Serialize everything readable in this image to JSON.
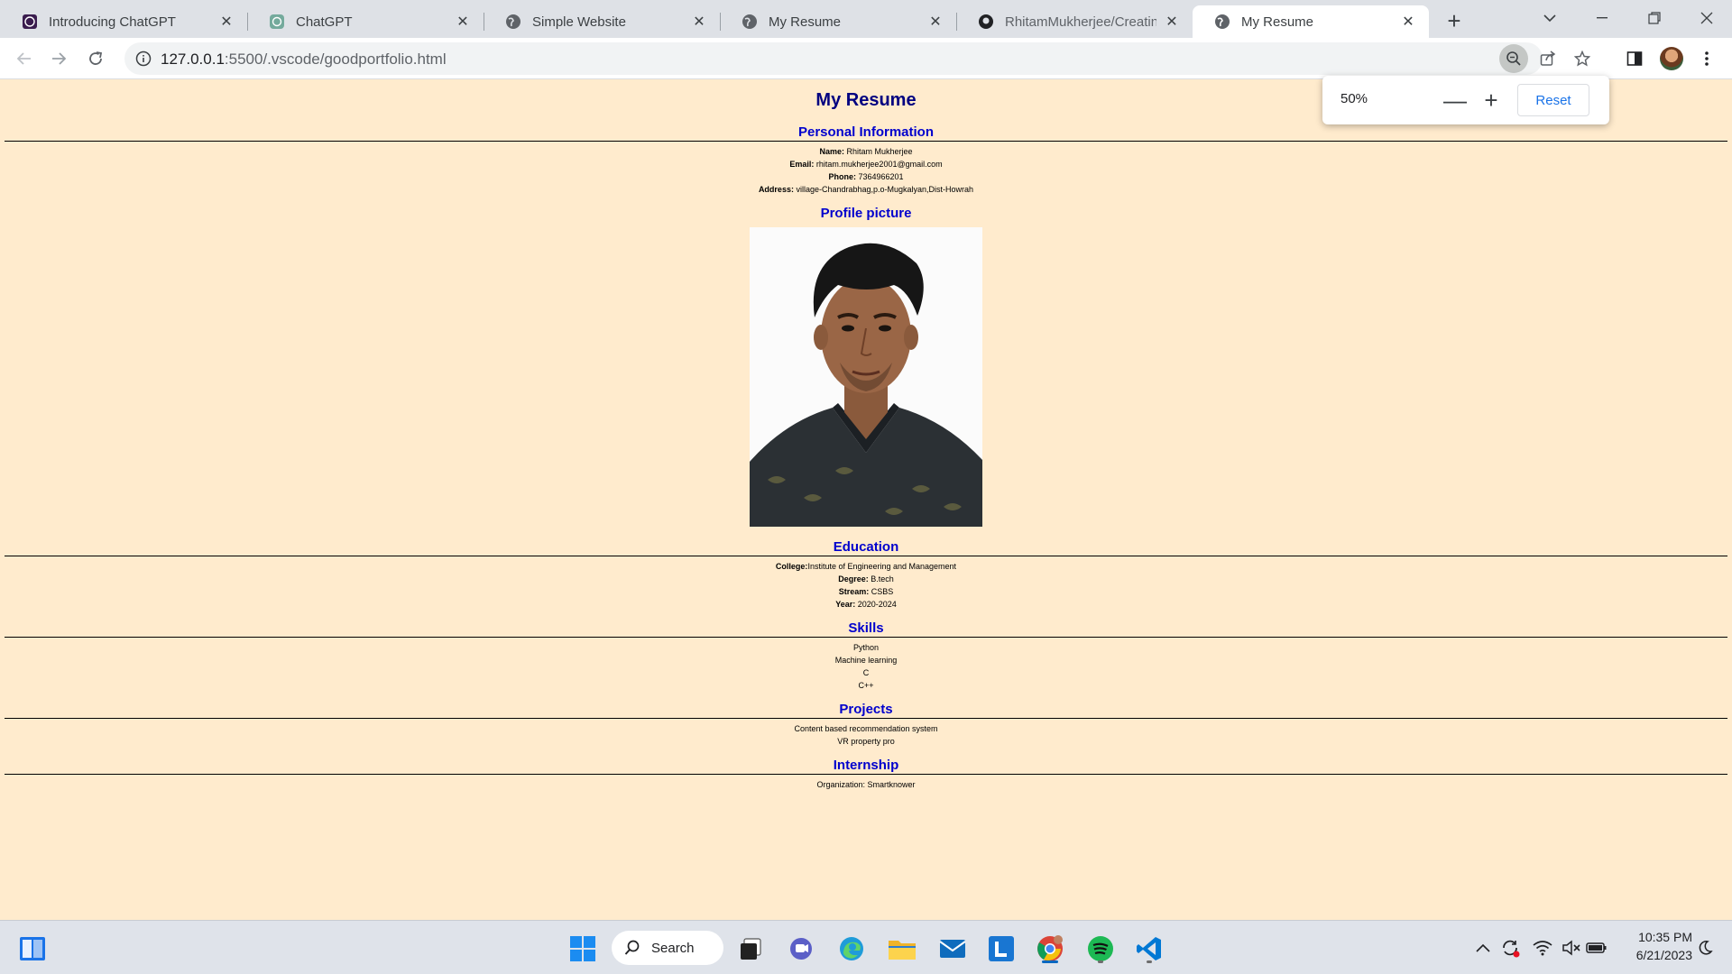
{
  "tabs": [
    {
      "title": "Introducing ChatGPT",
      "icon": "openai-icon"
    },
    {
      "title": "ChatGPT",
      "icon": "chatgpt-icon"
    },
    {
      "title": "Simple Website",
      "icon": "globe-icon"
    },
    {
      "title": "My Resume",
      "icon": "globe-icon"
    },
    {
      "title": "RhitamMukherjee/Creating",
      "icon": "github-icon"
    },
    {
      "title": "My Resume",
      "icon": "globe-icon",
      "active": true
    }
  ],
  "address_bar": {
    "host": "127.0.0.1",
    "path": ":5500/.vscode/goodportfolio.html"
  },
  "zoom_popup": {
    "level": "50%",
    "minus": "—",
    "plus": "+",
    "reset_label": "Reset"
  },
  "resume": {
    "title": "My Resume",
    "personal": {
      "heading": "Personal Information",
      "name_label": "Name:",
      "name": " Rhitam Mukherjee",
      "email_label": "Email:",
      "email": " rhitam.mukherjee2001@gmail.com",
      "phone_label": "Phone:",
      "phone": " 7364966201",
      "address_label": "Address:",
      "address": " village-Chandrabhag,p.o-Mugkalyan,Dist-Howrah"
    },
    "profile_picture_heading": "Profile picture",
    "education": {
      "heading": "Education",
      "college_label": "College:",
      "college": "Institute of Engineering and Management",
      "degree_label": "Degree:",
      "degree": " B.tech",
      "stream_label": "Stream:",
      "stream": " CSBS",
      "year_label": "Year:",
      "year": " 2020-2024"
    },
    "skills": {
      "heading": "Skills",
      "items": [
        "Python",
        "Machine learning",
        "C",
        "C++"
      ]
    },
    "projects": {
      "heading": "Projects",
      "items": [
        "Content based recommendation system",
        "VR property pro"
      ]
    },
    "internship": {
      "heading": "Internship",
      "organization": "Organization: Smartknower"
    }
  },
  "taskbar": {
    "search_label": "Search",
    "time": "10:35 PM",
    "date": "6/21/2023"
  },
  "colors": {
    "page_bg": "#ffebcd",
    "title": "#000080",
    "heading": "#0000cd",
    "accent": "#1a73e8"
  }
}
